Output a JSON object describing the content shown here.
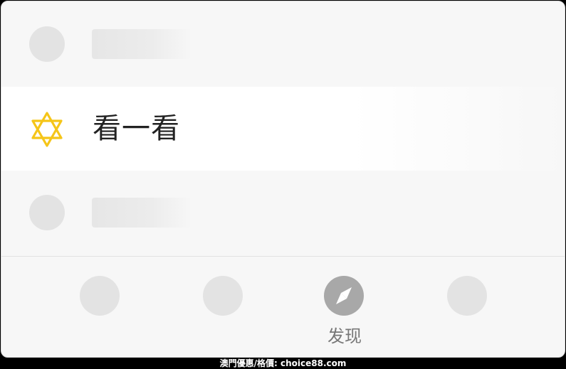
{
  "menu": {
    "featured_item": {
      "label": "看一看",
      "icon": "six-point-star-icon",
      "icon_color": "#f5c518"
    }
  },
  "tabbar": {
    "active_tab": {
      "label": "发现",
      "icon": "compass-icon",
      "icon_color": "#a8a8a8"
    }
  },
  "watermark": {
    "text": "澳門優惠/格價: choice88.com"
  }
}
